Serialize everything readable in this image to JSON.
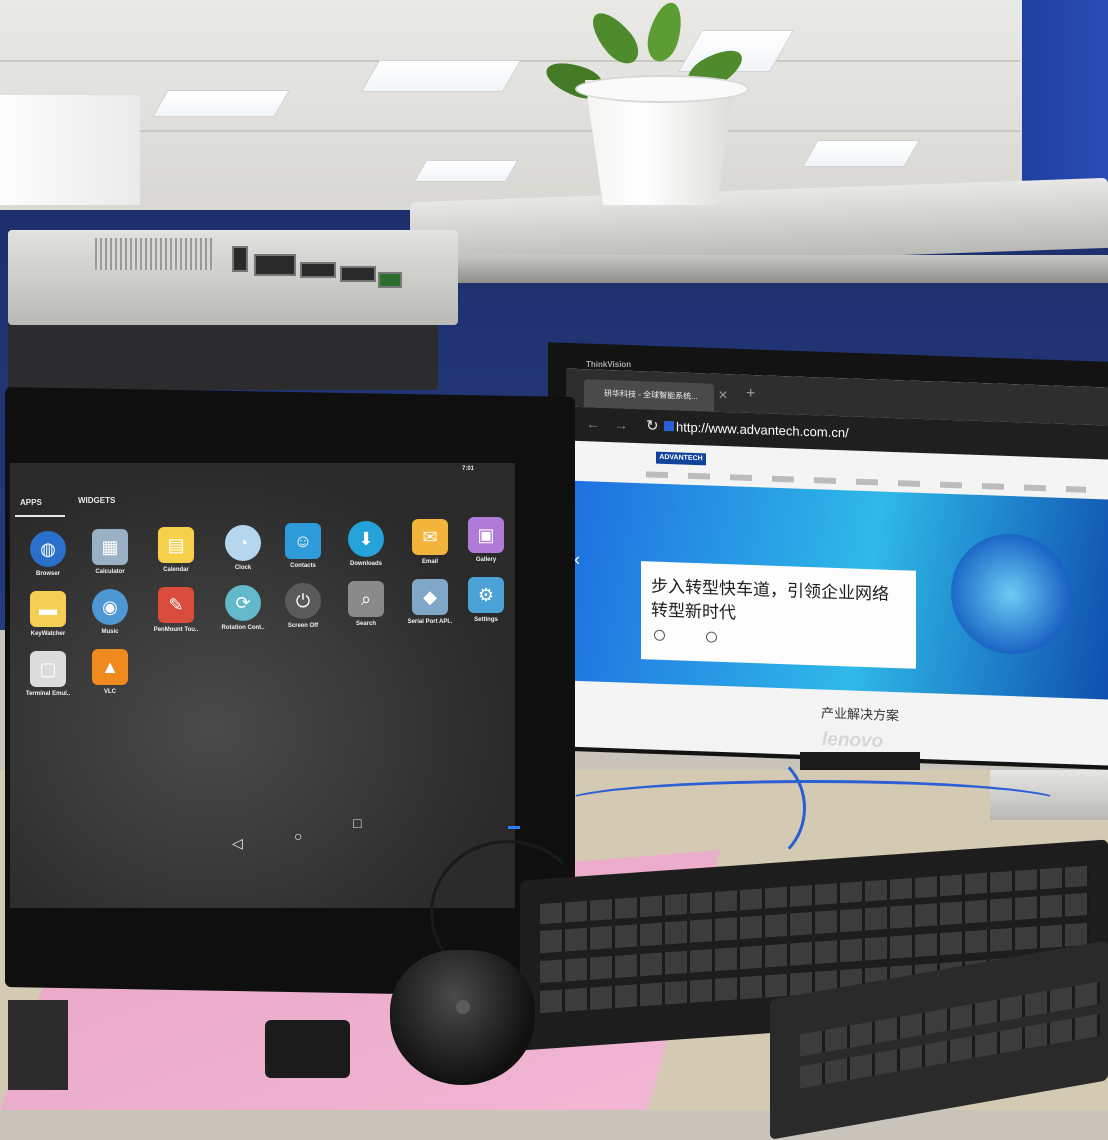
{
  "tablet": {
    "tabs": [
      "APPS",
      "WIDGETS"
    ],
    "status_time": "7:01",
    "apps": [
      {
        "label": "Browser",
        "icon": "globe-icon",
        "color": "#2a6fc9"
      },
      {
        "label": "Calculator",
        "icon": "calculator-icon",
        "color": "#9ab0c4"
      },
      {
        "label": "Calendar",
        "icon": "calendar-icon",
        "color": "#f5d14a"
      },
      {
        "label": "Clock",
        "icon": "clock-icon",
        "color": "#b5d7ee"
      },
      {
        "label": "Contacts",
        "icon": "contacts-icon",
        "color": "#2f9bd8"
      },
      {
        "label": "Downloads",
        "icon": "download-icon",
        "color": "#25a3d8"
      },
      {
        "label": "Email",
        "icon": "email-icon",
        "color": "#f2b43a"
      },
      {
        "label": "Gallery",
        "icon": "gallery-icon",
        "color": "#b07ad6"
      },
      {
        "label": "KeyWatcher",
        "icon": "folder-icon",
        "color": "#f3cf53"
      },
      {
        "label": "Music",
        "icon": "music-icon",
        "color": "#4d97d4"
      },
      {
        "label": "PenMount Tou..",
        "icon": "pen-icon",
        "color": "#d94b3a"
      },
      {
        "label": "Rotation Cont..",
        "icon": "rotation-icon",
        "color": "#63b9c9"
      },
      {
        "label": "Screen Off",
        "icon": "power-icon",
        "color": "#5a5a5a"
      },
      {
        "label": "Search",
        "icon": "search-icon",
        "color": "#8a8a8a"
      },
      {
        "label": "Serial Port API..",
        "icon": "serial-port-icon",
        "color": "#7fa7c8"
      },
      {
        "label": "Settings",
        "icon": "gear-icon",
        "color": "#4aa2d6"
      },
      {
        "label": "Terminal Emul..",
        "icon": "terminal-icon",
        "color": "#dcdcdc"
      },
      {
        "label": "VLC",
        "icon": "vlc-cone-icon",
        "color": "#f08a1e"
      }
    ]
  },
  "browser": {
    "tab_title": "研华科技 - 全球智能系统...",
    "url": "http://www.advantech.com.cn/",
    "brand": "ADVANTECH",
    "hero_line1": "步入转型快车道，引领企业网络",
    "hero_line2": "转型新时代",
    "section_title": "产业解决方案"
  },
  "monitor": {
    "brand_top": "ThinkVision",
    "brand_bottom": "lenovo"
  }
}
